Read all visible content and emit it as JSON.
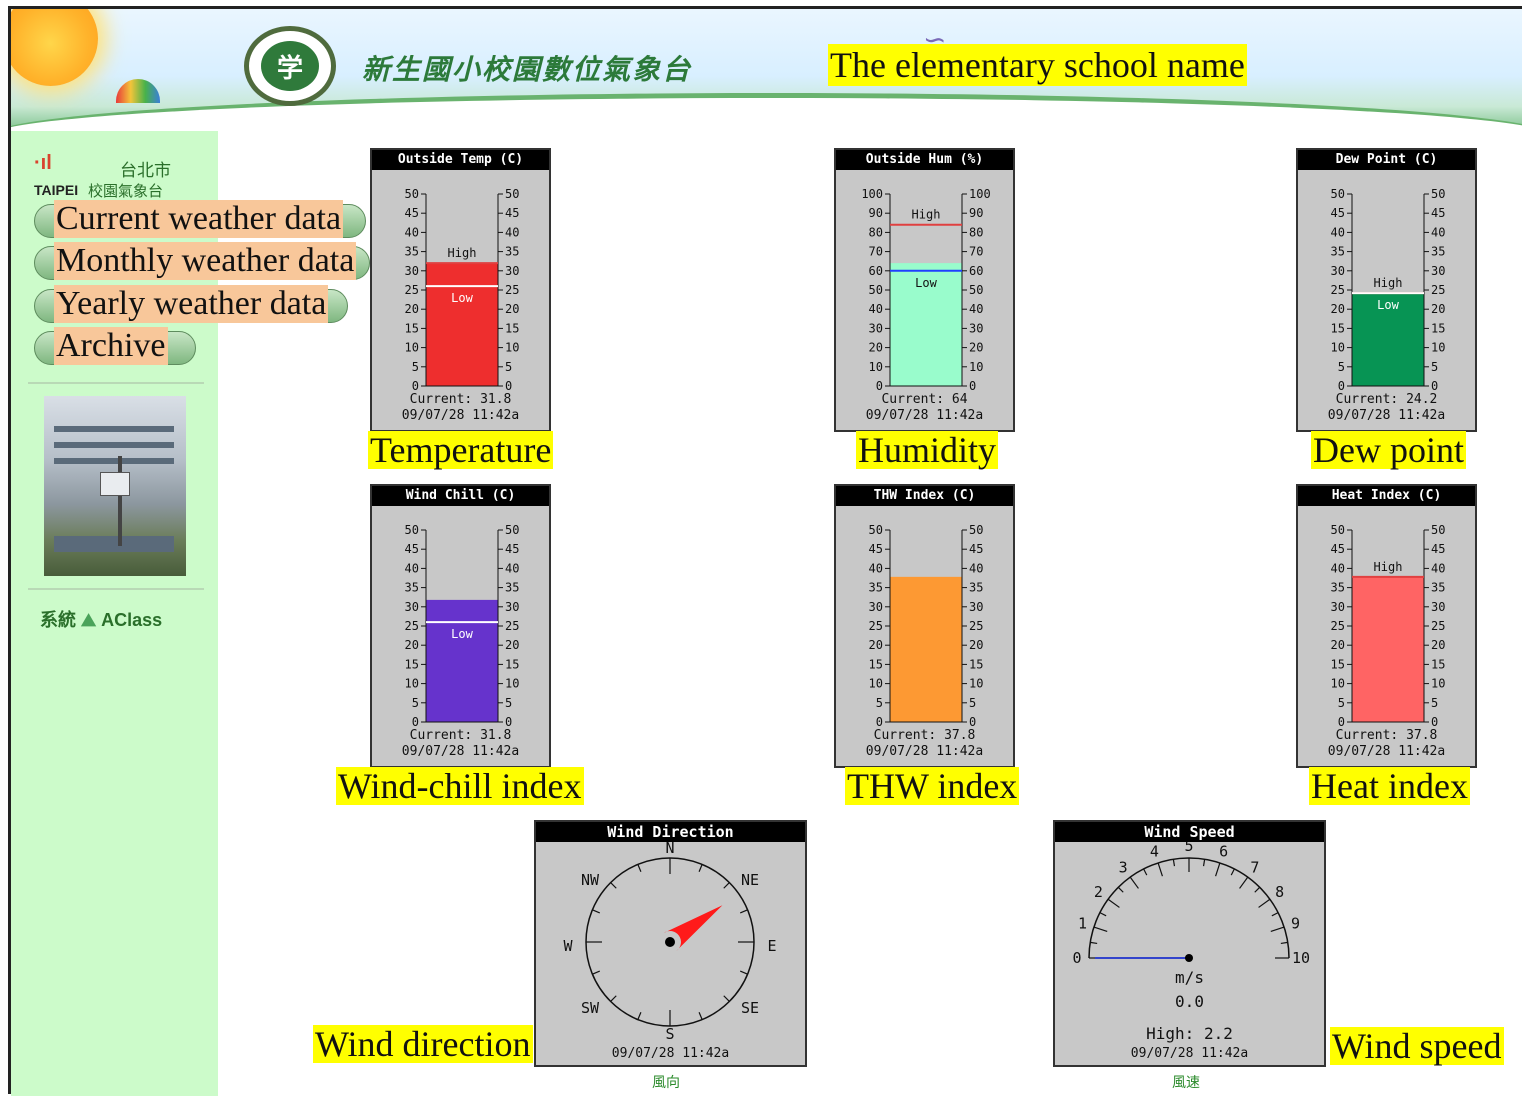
{
  "header": {
    "cn_title": "新生國小校園數位氣象台",
    "en_title": "The elementary school name",
    "seal_glyph": "学"
  },
  "sidebar": {
    "taipei_logo": "TAIPEI",
    "taipei_cn": "台北市",
    "taipei_cn2": "校園氣象台",
    "items": [
      {
        "label": "Current weather data"
      },
      {
        "label": "Monthly weather data"
      },
      {
        "label": "Yearly weather data"
      },
      {
        "label": "Archive"
      }
    ],
    "system_cn": "系統",
    "system_brand": "AClass"
  },
  "colors": {
    "temperature": "#ee2e2e",
    "humidity": "#99fccc",
    "dew_point": "#079454",
    "wind_chill": "#6633cc",
    "thw": "#fd9933",
    "heat": "#ff6464"
  },
  "gauges": [
    {
      "title": "Outside Temp (C)",
      "scale": [
        0,
        50
      ],
      "ticks": [
        0,
        5,
        10,
        15,
        20,
        25,
        30,
        35,
        40,
        45,
        50
      ],
      "value": 31.8,
      "high": 32,
      "low": 26,
      "high_label": "High",
      "low_label": "Low",
      "current": "Current: 31.8",
      "time": "09/07/28 11:42a",
      "caption": "Temperature",
      "color": "#ee2e2e"
    },
    {
      "title": "Outside Hum (%)",
      "scale": [
        0,
        100
      ],
      "ticks": [
        0,
        10,
        20,
        30,
        40,
        50,
        60,
        70,
        80,
        90,
        100
      ],
      "value": 64,
      "high": 84,
      "low": 60,
      "high_label": "High",
      "low_label": "Low",
      "current": "Current: 64",
      "time": "09/07/28 11:42a",
      "caption": "Humidity",
      "color": "#99fccc"
    },
    {
      "title": "Dew Point (C)",
      "scale": [
        0,
        50
      ],
      "ticks": [
        0,
        5,
        10,
        15,
        20,
        25,
        30,
        35,
        40,
        45,
        50
      ],
      "value": 24.2,
      "high": 24.2,
      "low": 24.2,
      "high_label": "High",
      "low_label": "Low",
      "current": "Current: 24.2",
      "time": "09/07/28 11:42a",
      "caption": "Dew point",
      "color": "#079454"
    },
    {
      "title": "Wind Chill (C)",
      "scale": [
        0,
        50
      ],
      "ticks": [
        0,
        5,
        10,
        15,
        20,
        25,
        30,
        35,
        40,
        45,
        50
      ],
      "value": 31.8,
      "high": null,
      "low": 26,
      "high_label": "",
      "low_label": "Low",
      "current": "Current: 31.8",
      "time": "09/07/28 11:42a",
      "caption": "Wind-chill index",
      "color": "#6633cc"
    },
    {
      "title": "THW Index (C)",
      "scale": [
        0,
        50
      ],
      "ticks": [
        0,
        5,
        10,
        15,
        20,
        25,
        30,
        35,
        40,
        45,
        50
      ],
      "value": 37.8,
      "high": null,
      "low": null,
      "high_label": "",
      "low_label": "",
      "current": "Current: 37.8",
      "time": "09/07/28 11:42a",
      "caption": "THW index",
      "color": "#fd9933"
    },
    {
      "title": "Heat Index (C)",
      "scale": [
        0,
        50
      ],
      "ticks": [
        0,
        5,
        10,
        15,
        20,
        25,
        30,
        35,
        40,
        45,
        50
      ],
      "value": 37.8,
      "high": 37.8,
      "low": null,
      "high_label": "High",
      "low_label": "",
      "current": "Current: 37.8",
      "time": "09/07/28 11:42a",
      "caption": "Heat index",
      "color": "#ff6464"
    }
  ],
  "wind_direction": {
    "title": "Wind Direction",
    "labels": {
      "N": "N",
      "NE": "NE",
      "E": "E",
      "SE": "SE",
      "S": "S",
      "SW": "SW",
      "W": "W",
      "NW": "NW"
    },
    "direction_deg": 55,
    "time": "09/07/28  11:42a",
    "cn_label": "風向",
    "caption": "Wind direction"
  },
  "wind_speed": {
    "title": "Wind Speed",
    "scale": [
      0,
      10
    ],
    "tick_labels": [
      "0",
      "1",
      "2",
      "3",
      "4",
      "5",
      "6",
      "7",
      "8",
      "9",
      "10"
    ],
    "value": 0.0,
    "unit": "m/s",
    "value_text": "0.0",
    "high_text": "High: 2.2",
    "time": "09/07/28  11:42a",
    "cn_label": "風速",
    "caption": "Wind speed"
  }
}
